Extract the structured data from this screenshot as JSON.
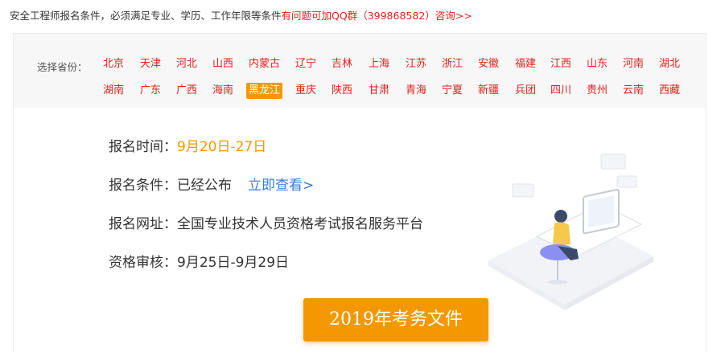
{
  "header": {
    "intro": "安全工程师报名条件，必须满足专业、学历、工作年限等条件",
    "qq_prefix": "有问题可加QQ群（",
    "qq_number": "399868582",
    "qq_suffix": "）咨询>>"
  },
  "provinces": {
    "label": "选择省份：",
    "selected": "黑龙江",
    "row1": [
      "北京",
      "天津",
      "河北",
      "山西",
      "内蒙古",
      "辽宁",
      "吉林",
      "上海",
      "江苏",
      "浙江",
      "安徽",
      "福建",
      "江西",
      "山东",
      "河南",
      "湖北"
    ],
    "row2": [
      "湖南",
      "广东",
      "广西",
      "海南",
      "黑龙江",
      "重庆",
      "陕西",
      "甘肃",
      "青海",
      "宁夏",
      "新疆",
      "兵团",
      "四川",
      "贵州",
      "云南",
      "西藏"
    ]
  },
  "info": {
    "reg_time_label": "报名时间：",
    "reg_time_value": "9月20日-27日",
    "reg_cond_label": "报名条件：",
    "reg_cond_value": "已经公布",
    "reg_cond_link": "立即查看>",
    "reg_site_label": "报名网址：",
    "reg_site_value": "全国专业技术人员资格考试报名服务平台",
    "review_label": "资格审核：",
    "review_value": "9月25日-9月29日"
  },
  "cta": {
    "label": "2019年考务文件"
  },
  "colors": {
    "accent": "#f39800",
    "link_red": "#e0221b",
    "link_blue": "#3a7bd5"
  },
  "illustration": {
    "icon": "person-at-computer-illustration"
  }
}
